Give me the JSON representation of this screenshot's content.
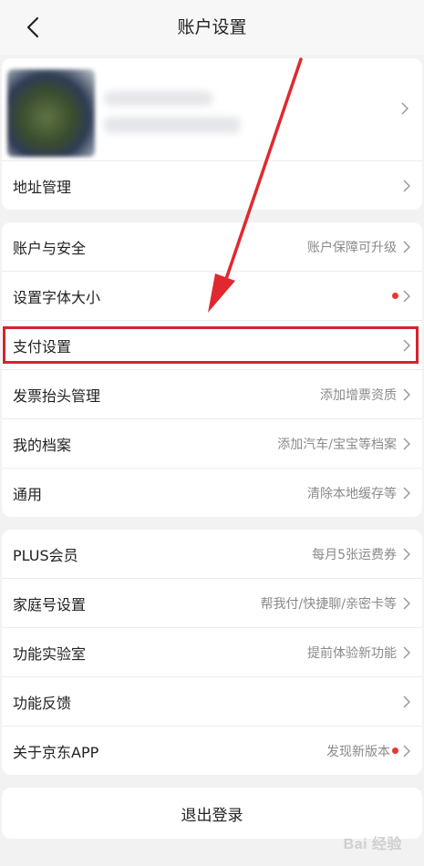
{
  "header": {
    "title": "账户设置",
    "back_icon": "chevron-left-icon"
  },
  "profile": {
    "address_label": "地址管理"
  },
  "group1": {
    "items": [
      {
        "label": "账户与安全",
        "value": "账户保障可升级",
        "dot": false
      },
      {
        "label": "设置字体大小",
        "value": "",
        "dot": true
      },
      {
        "label": "支付设置",
        "value": "",
        "dot": false,
        "highlighted": true
      },
      {
        "label": "发票抬头管理",
        "value": "添加增票资质",
        "dot": false
      },
      {
        "label": "我的档案",
        "value": "添加汽车/宝宝等档案",
        "dot": false
      },
      {
        "label": "通用",
        "value": "清除本地缓存等",
        "dot": false
      }
    ]
  },
  "group2": {
    "items": [
      {
        "label": "PLUS会员",
        "value": "每月5张运费券",
        "dot": false
      },
      {
        "label": "家庭号设置",
        "value": "帮我付/快捷聊/亲密卡等",
        "dot": false
      },
      {
        "label": "功能实验室",
        "value": "提前体验新功能",
        "dot": false
      },
      {
        "label": "功能反馈",
        "value": "",
        "dot": false
      },
      {
        "label": "关于京东APP",
        "value": "发现新版本",
        "dot": true
      }
    ]
  },
  "logout": {
    "label": "退出登录"
  },
  "watermark": {
    "text": "Bai 经验"
  },
  "colors": {
    "accent_red": "#d62230",
    "dot_red": "#e8382f",
    "chevron": "#9a9a9a"
  }
}
